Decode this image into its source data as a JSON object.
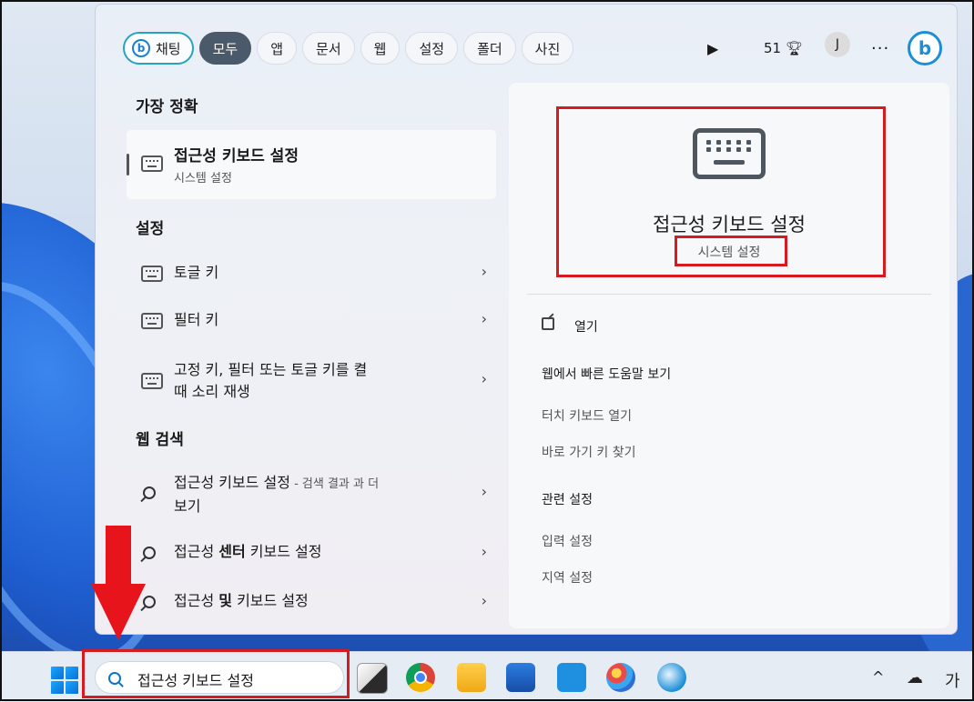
{
  "filters": {
    "chat": "채팅",
    "items": [
      "모두",
      "앱",
      "문서",
      "웹",
      "설정",
      "폴더",
      "사진"
    ],
    "active": "모두"
  },
  "header": {
    "points": "51",
    "avatar": "J",
    "more": "···"
  },
  "left": {
    "best_match_heading": "가장 정확",
    "best_match": {
      "title": "접근성 키보드 설정",
      "subtitle": "시스템 설정"
    },
    "settings_heading": "설정",
    "settings_items": [
      {
        "label": "토글 키"
      },
      {
        "label": "필터 키"
      },
      {
        "label_line1": "고정 키, 필터 또는 토글 키를 켤",
        "label_line2": "때 소리 재생"
      }
    ],
    "web_heading": "웹 검색",
    "web_items": [
      {
        "prefix": "접근성 키보드 설정",
        "suffix": " - 검색 결과 과 더",
        "line2": "보기"
      },
      {
        "pre": "접근성 ",
        "bold": "센터",
        "post": " 키보드 설정"
      },
      {
        "pre": "접근성 ",
        "bold": "및",
        "post": " 키보드 설정"
      }
    ]
  },
  "detail": {
    "title": "접근성 키보드 설정",
    "subtitle": "시스템 설정",
    "open": "열기",
    "web_help": "웹에서 빠른 도움말 보기",
    "actions": [
      "터치 키보드 열기",
      "바로 가기 키 찾기"
    ],
    "related_heading": "관련 설정",
    "related": [
      "입력 설정",
      "지역 설정"
    ]
  },
  "taskbar": {
    "search_value": "접근성 키보드 설정",
    "ime": "가",
    "tray_chevron": "^"
  },
  "colors": {
    "highlight": "#d71920",
    "accent": "#0a74c9",
    "chip_active": "#4a5a6a"
  }
}
